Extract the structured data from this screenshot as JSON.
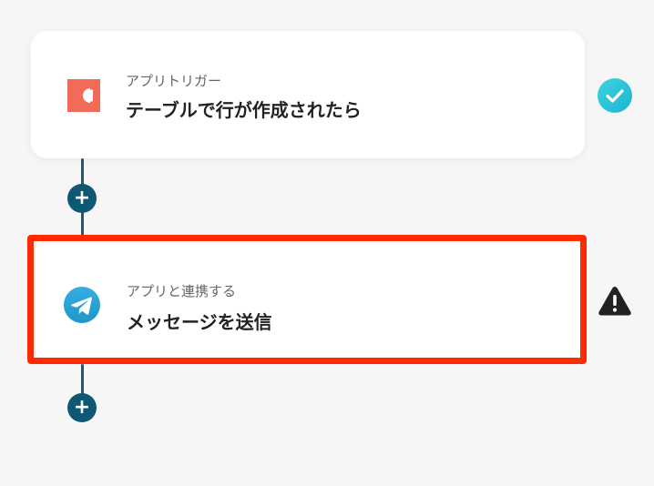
{
  "flow": {
    "steps": [
      {
        "subtitle": "アプリトリガー",
        "title": "テーブルで行が作成されたら",
        "icon": "coda-app-icon",
        "status": "success-check-icon"
      },
      {
        "subtitle": "アプリと連携する",
        "title": "メッセージを送信",
        "icon": "telegram-app-icon",
        "status": "warning-icon"
      }
    ],
    "add_button_label": "+"
  },
  "colors": {
    "connector": "#1e5a75",
    "add_button": "#0f5873",
    "coda": "#f26b58",
    "telegram": "#2aa3df",
    "success": "#2bc6d9",
    "warning": "#222222",
    "highlight": "#ff2a00"
  }
}
